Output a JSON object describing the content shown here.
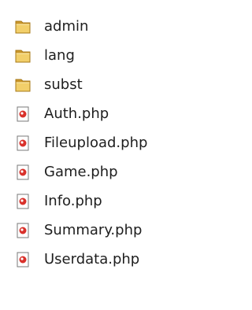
{
  "files": [
    {
      "name": "admin",
      "type": "folder",
      "icon": "folder-icon"
    },
    {
      "name": "lang",
      "type": "folder",
      "icon": "folder-icon"
    },
    {
      "name": "subst",
      "type": "folder",
      "icon": "folder-icon"
    },
    {
      "name": "Auth.php",
      "type": "file",
      "icon": "php-file-icon"
    },
    {
      "name": "Fileupload.php",
      "type": "file",
      "icon": "php-file-icon"
    },
    {
      "name": "Game.php",
      "type": "file",
      "icon": "php-file-icon"
    },
    {
      "name": "Info.php",
      "type": "file",
      "icon": "php-file-icon"
    },
    {
      "name": "Summary.php",
      "type": "file",
      "icon": "php-file-icon"
    },
    {
      "name": "Userdata.php",
      "type": "file",
      "icon": "php-file-icon"
    }
  ],
  "colors": {
    "folder_back": "#c9962b",
    "folder_front": "#f2cf6a",
    "file_border": "#7a7a7a",
    "file_badge": "#d9312b",
    "text": "#1e1e1e"
  }
}
